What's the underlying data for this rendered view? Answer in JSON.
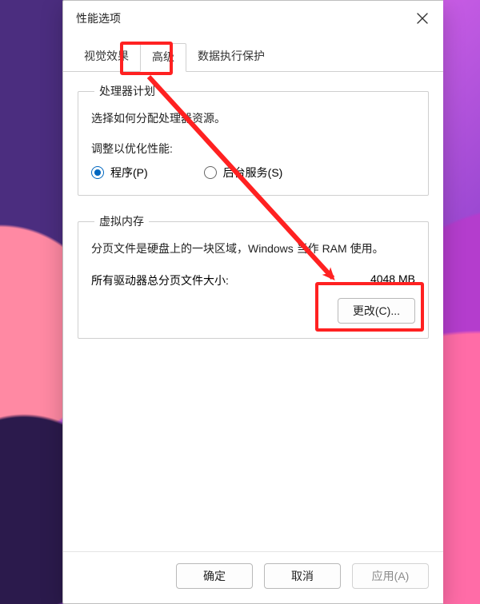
{
  "window": {
    "title": "性能选项"
  },
  "tabs": [
    "视觉效果",
    "高级",
    "数据执行保护"
  ],
  "active_tab_index": 1,
  "processor": {
    "legend": "处理器计划",
    "desc": "选择如何分配处理器资源。",
    "subhead": "调整以优化性能:",
    "radios": {
      "programs": "程序(P)",
      "background": "后台服务(S)"
    },
    "selected": "programs"
  },
  "virtual_memory": {
    "legend": "虚拟内存",
    "desc": "分页文件是硬盘上的一块区域，Windows 当作 RAM 使用。",
    "size_label": "所有驱动器总分页文件大小:",
    "size_value": "4048 MB",
    "change_label": "更改(C)..."
  },
  "footer": {
    "ok": "确定",
    "cancel": "取消",
    "apply": "应用(A)"
  },
  "annotation": {
    "color": "#ff2121"
  }
}
